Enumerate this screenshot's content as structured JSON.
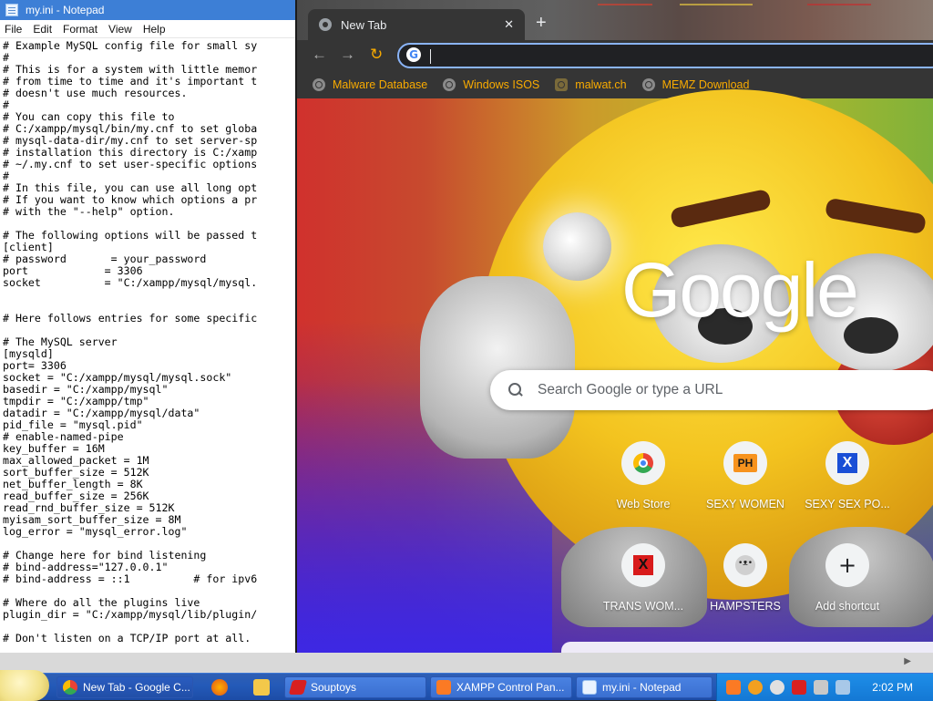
{
  "notepad": {
    "title": "my.ini - Notepad",
    "menu": [
      "File",
      "Edit",
      "Format",
      "View",
      "Help"
    ],
    "content": [
      "# Example MySQL config file for small sy",
      "#",
      "# This is for a system with little memor",
      "# from time to time and it's important t",
      "# doesn't use much resources.",
      "#",
      "# You can copy this file to",
      "# C:/xampp/mysql/bin/my.cnf to set globa",
      "# mysql-data-dir/my.cnf to set server-sp",
      "# installation this directory is C:/xamp",
      "# ~/.my.cnf to set user-specific options",
      "#",
      "# In this file, you can use all long opt",
      "# If you want to know which options a pr",
      "# with the \"--help\" option.",
      "",
      "# The following options will be passed t",
      "[client]",
      "# password       = your_password",
      "port            = 3306",
      "socket          = \"C:/xampp/mysql/mysql.",
      "",
      "",
      "# Here follows entries for some specific",
      "",
      "# The MySQL server",
      "[mysqld]",
      "port= 3306",
      "socket = \"C:/xampp/mysql/mysql.sock\"",
      "basedir = \"C:/xampp/mysql\"",
      "tmpdir = \"C:/xampp/tmp\"",
      "datadir = \"C:/xampp/mysql/data\"",
      "pid_file = \"mysql.pid\"",
      "# enable-named-pipe",
      "key_buffer = 16M",
      "max_allowed_packet = 1M",
      "sort_buffer_size = 512K",
      "net_buffer_length = 8K",
      "read_buffer_size = 256K",
      "read_rnd_buffer_size = 512K",
      "myisam_sort_buffer_size = 8M",
      "log_error = \"mysql_error.log\"",
      "",
      "# Change here for bind listening",
      "# bind-address=\"127.0.0.1\"",
      "# bind-address = ::1          # for ipv6",
      "",
      "# Where do all the plugins live",
      "plugin_dir = \"C:/xampp/mysql/lib/plugin/",
      "",
      "# Don't listen on a TCP/IP port at all."
    ]
  },
  "chrome": {
    "tab_title": "New Tab",
    "tab_close": "✕",
    "new_tab": "+",
    "nav": {
      "back": "←",
      "forward": "→",
      "reload": "↻"
    },
    "omnibox_icon": "G",
    "bookmarks": [
      {
        "label": "Malware Database",
        "icon": "globe-icon"
      },
      {
        "label": "Windows ISOS",
        "icon": "globe-icon"
      },
      {
        "label": "malwat.ch",
        "icon": "person-icon"
      },
      {
        "label": "MEMZ Download",
        "icon": "globe-icon"
      }
    ],
    "logo": "Google",
    "search_placeholder": "Search Google or type a URL",
    "shortcuts": [
      {
        "label": "Web Store",
        "icon": "webstore-icon"
      },
      {
        "label": "SEXY WOMEN",
        "icon": "ph-icon",
        "badge": "PH"
      },
      {
        "label": "SEXY SEX PO...",
        "icon": "x-icon",
        "badge": "X"
      },
      {
        "label": "TRANS WOM...",
        "icon": "x-icon",
        "badge": "X"
      },
      {
        "label": "HAMPSTERS",
        "icon": "hamster-icon"
      },
      {
        "label": "Add shortcut",
        "icon": "plus-icon",
        "badge": "+"
      }
    ]
  },
  "taskbar": {
    "buttons": [
      {
        "label": "New Tab - Google C...",
        "active": true
      },
      {
        "label": "Souptoys",
        "active": false
      },
      {
        "label": "XAMPP Control Pan...",
        "active": false
      },
      {
        "label": "my.ini - Notepad",
        "active": false
      }
    ],
    "clock": "2:02 PM"
  },
  "colors": {
    "bookmark_text": "#f9ab00",
    "taskbar": "#245ab8",
    "tray": "#1478d4",
    "omnibox_border": "#8ab4f8"
  }
}
